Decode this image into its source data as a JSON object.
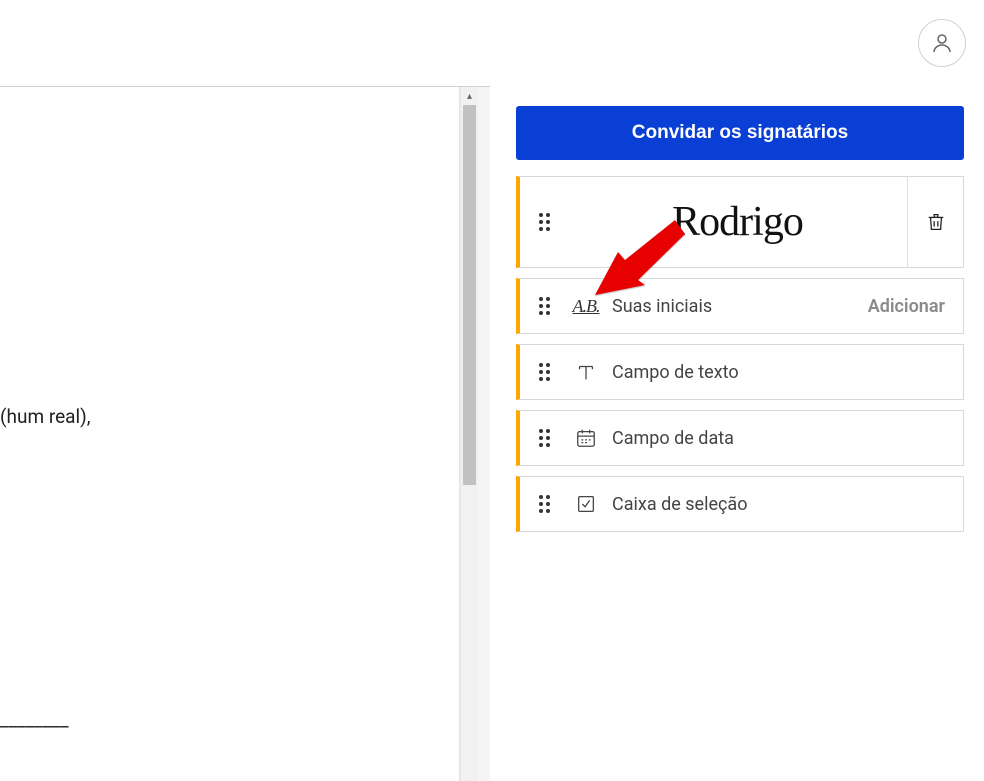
{
  "header": {
    "avatar_name": "user-avatar"
  },
  "document": {
    "text_snippet": "(hum real),",
    "underline": "________"
  },
  "sidebar": {
    "invite_button_label": "Convidar os signatários",
    "signature": {
      "value": "Rodrigo"
    },
    "fields": [
      {
        "icon": "initials",
        "icon_text": "A.B.",
        "label": "Suas iniciais",
        "action": "Adicionar"
      },
      {
        "icon": "text",
        "label": "Campo de texto",
        "action": ""
      },
      {
        "icon": "date",
        "label": "Campo de data",
        "action": ""
      },
      {
        "icon": "checkbox",
        "label": "Caixa de seleção",
        "action": ""
      }
    ]
  }
}
